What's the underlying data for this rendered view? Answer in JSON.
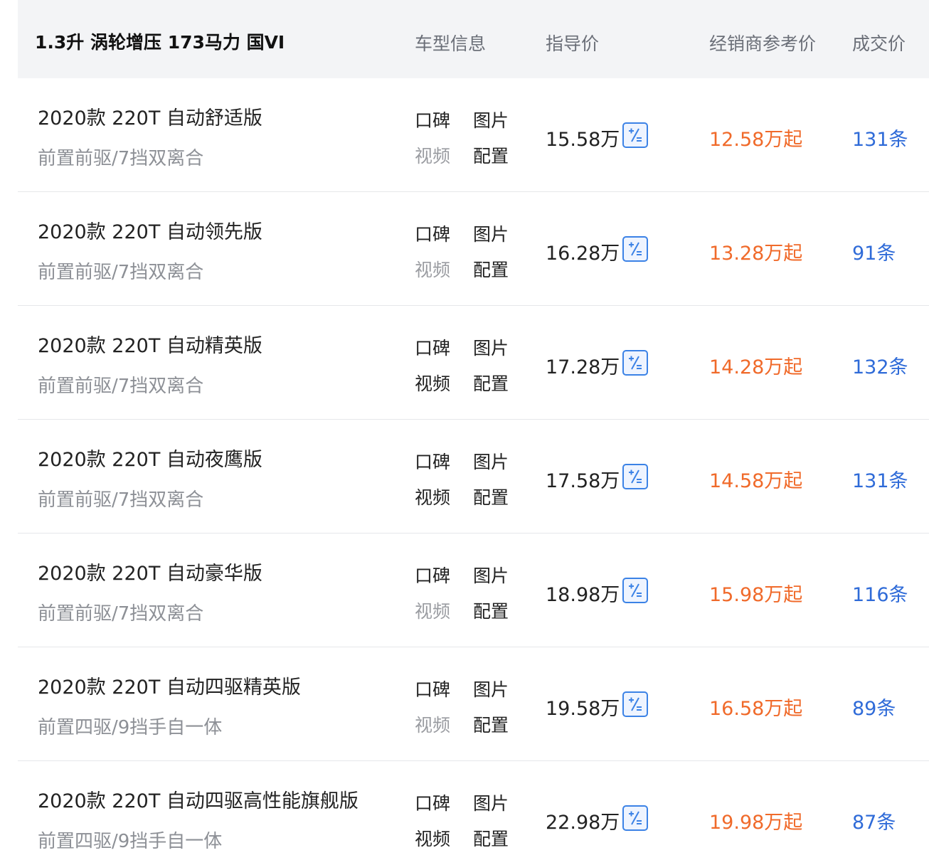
{
  "header": {
    "title": "1.3升 涡轮增压 173马力 国VI",
    "col_info": "车型信息",
    "col_guide": "指导价",
    "col_dealer": "经销商参考价",
    "col_deal": "成交价"
  },
  "links": {
    "koubei": "口碑",
    "tupian": "图片",
    "shipin": "视频",
    "peizhi": "配置"
  },
  "icons": {
    "calculator": "calculator-icon"
  },
  "colors": {
    "dealer_price": "#f06a2a",
    "deal_count": "#2f6bd8",
    "icon_accent": "#3b82e6"
  },
  "rows": [
    {
      "name": "2020款 220T 自动舒适版",
      "spec": "前置前驱/7挡双离合",
      "guide_price": "15.58万",
      "dealer_price": "12.58万起",
      "deals": "131条",
      "video_muted": true
    },
    {
      "name": "2020款 220T 自动领先版",
      "spec": "前置前驱/7挡双离合",
      "guide_price": "16.28万",
      "dealer_price": "13.28万起",
      "deals": "91条",
      "video_muted": true
    },
    {
      "name": "2020款 220T 自动精英版",
      "spec": "前置前驱/7挡双离合",
      "guide_price": "17.28万",
      "dealer_price": "14.28万起",
      "deals": "132条",
      "video_muted": false
    },
    {
      "name": "2020款 220T 自动夜鹰版",
      "spec": "前置前驱/7挡双离合",
      "guide_price": "17.58万",
      "dealer_price": "14.58万起",
      "deals": "131条",
      "video_muted": false
    },
    {
      "name": "2020款 220T 自动豪华版",
      "spec": "前置前驱/7挡双离合",
      "guide_price": "18.98万",
      "dealer_price": "15.98万起",
      "deals": "116条",
      "video_muted": true
    },
    {
      "name": "2020款 220T 自动四驱精英版",
      "spec": "前置四驱/9挡手自一体",
      "guide_price": "19.58万",
      "dealer_price": "16.58万起",
      "deals": "89条",
      "video_muted": true
    },
    {
      "name": "2020款 220T 自动四驱高性能旗舰版",
      "spec": "前置四驱/9挡手自一体",
      "guide_price": "22.98万",
      "dealer_price": "19.98万起",
      "deals": "87条",
      "video_muted": false
    }
  ]
}
